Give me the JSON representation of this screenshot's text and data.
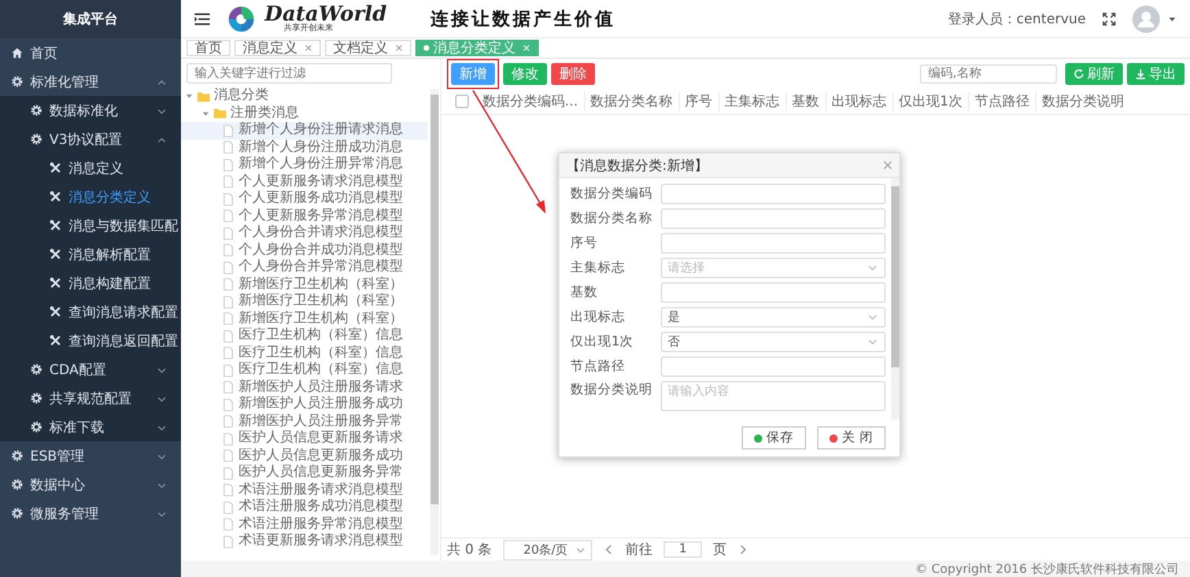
{
  "sidebar": {
    "title": "集成平台",
    "items": [
      {
        "label": "首页",
        "kind": "link"
      },
      {
        "label": "标准化管理",
        "kind": "group",
        "expanded": true,
        "children": [
          {
            "label": "数据标准化",
            "kind": "group",
            "expanded": false
          },
          {
            "label": "V3协议配置",
            "kind": "group",
            "expanded": true,
            "children": [
              {
                "label": "消息定义",
                "kind": "page",
                "selected": false
              },
              {
                "label": "消息分类定义",
                "kind": "page",
                "selected": true
              },
              {
                "label": "消息与数据集匹配",
                "kind": "page",
                "selected": false
              },
              {
                "label": "消息解析配置",
                "kind": "page",
                "selected": false
              },
              {
                "label": "消息构建配置",
                "kind": "page",
                "selected": false
              },
              {
                "label": "查询消息请求配置",
                "kind": "page",
                "selected": false
              },
              {
                "label": "查询消息返回配置",
                "kind": "page",
                "selected": false
              }
            ]
          },
          {
            "label": "CDA配置",
            "kind": "group",
            "expanded": false
          },
          {
            "label": "共享规范配置",
            "kind": "group",
            "expanded": false
          },
          {
            "label": "标准下载",
            "kind": "group",
            "expanded": false
          }
        ]
      },
      {
        "label": "ESB管理",
        "kind": "group",
        "expanded": false
      },
      {
        "label": "数据中心",
        "kind": "group",
        "expanded": false
      },
      {
        "label": "微服务管理",
        "kind": "group",
        "expanded": false
      }
    ]
  },
  "header": {
    "logo": {
      "name": "DataWorld",
      "tagline": "共享开创未来"
    },
    "slogan": "连接让数据产生价值",
    "user": "登录人员：centervue"
  },
  "tabs": [
    {
      "label": "首页",
      "closable": false,
      "selected": false
    },
    {
      "label": "消息定义",
      "closable": true,
      "selected": false
    },
    {
      "label": "文档定义",
      "closable": true,
      "selected": false
    },
    {
      "label": "消息分类定义",
      "closable": true,
      "selected": true
    }
  ],
  "tree": {
    "filter_placeholder": "输入关键字进行过滤",
    "nodes": [
      {
        "label": "消息分类",
        "kind": "folder",
        "expanded": true,
        "children": [
          {
            "label": "注册类消息",
            "kind": "folder",
            "expanded": true,
            "children": [
              {
                "label": "新增个人身份注册请求消息",
                "kind": "file",
                "selected": true
              },
              {
                "label": "新增个人身份注册成功消息",
                "kind": "file",
                "selected": false
              },
              {
                "label": "新增个人身份注册异常消息",
                "kind": "file",
                "selected": false
              },
              {
                "label": "个人更新服务请求消息模型",
                "kind": "file",
                "selected": false
              },
              {
                "label": "个人更新服务成功消息模型",
                "kind": "file",
                "selected": false
              },
              {
                "label": "个人更新服务异常消息模型",
                "kind": "file",
                "selected": false
              },
              {
                "label": "个人身份合并请求消息模型",
                "kind": "file",
                "selected": false
              },
              {
                "label": "个人身份合并成功消息模型",
                "kind": "file",
                "selected": false
              },
              {
                "label": "个人身份合并异常消息模型",
                "kind": "file",
                "selected": false
              },
              {
                "label": "新增医疗卫生机构（科室）",
                "kind": "file",
                "selected": false
              },
              {
                "label": "新增医疗卫生机构（科室）",
                "kind": "file",
                "selected": false
              },
              {
                "label": "新增医疗卫生机构（科室）",
                "kind": "file",
                "selected": false
              },
              {
                "label": "医疗卫生机构（科室）信息",
                "kind": "file",
                "selected": false
              },
              {
                "label": "医疗卫生机构（科室）信息",
                "kind": "file",
                "selected": false
              },
              {
                "label": "医疗卫生机构（科室）信息",
                "kind": "file",
                "selected": false
              },
              {
                "label": "新增医护人员注册服务请求",
                "kind": "file",
                "selected": false
              },
              {
                "label": "新增医护人员注册服务成功",
                "kind": "file",
                "selected": false
              },
              {
                "label": "新增医护人员注册服务异常",
                "kind": "file",
                "selected": false
              },
              {
                "label": "医护人员信息更新服务请求",
                "kind": "file",
                "selected": false
              },
              {
                "label": "医护人员信息更新服务成功",
                "kind": "file",
                "selected": false
              },
              {
                "label": "医护人员信息更新服务异常",
                "kind": "file",
                "selected": false
              },
              {
                "label": "术语注册服务请求消息模型",
                "kind": "file",
                "selected": false
              },
              {
                "label": "术语注册服务成功消息模型",
                "kind": "file",
                "selected": false
              },
              {
                "label": "术语注册服务异常消息模型",
                "kind": "file",
                "selected": false
              },
              {
                "label": "术语更新服务请求消息模型",
                "kind": "file",
                "selected": false
              }
            ]
          }
        ]
      }
    ]
  },
  "toolbar": {
    "buttons": [
      {
        "label": "新增",
        "kind": "add",
        "highlighted": true
      },
      {
        "label": "修改",
        "kind": "edit",
        "highlighted": false
      },
      {
        "label": "删除",
        "kind": "delete",
        "highlighted": false
      }
    ],
    "search_placeholder": "编码,名称",
    "actions": [
      {
        "label": "刷新",
        "kind": "refresh"
      },
      {
        "label": "导出",
        "kind": "export"
      }
    ]
  },
  "table": {
    "select_all": false,
    "columns": [
      "数据分类编码...",
      "数据分类名称",
      "序号",
      "主集标志",
      "基数",
      "出现标志",
      "仅出现1次",
      "节点路径",
      "数据分类说明"
    ]
  },
  "pagination": {
    "total": "共 0 条",
    "page_size": "20条/页",
    "goto": "前往",
    "page": "1",
    "page_unit": "页"
  },
  "annotation": {
    "arrow": true
  },
  "dialog": {
    "title": "【消息数据分类:新增】",
    "fields": [
      {
        "label": "数据分类编码",
        "kind": "text"
      },
      {
        "label": "数据分类名称",
        "kind": "text"
      },
      {
        "label": "序号",
        "kind": "text"
      },
      {
        "label": "主集标志",
        "kind": "select",
        "placeholder": "请选择"
      },
      {
        "label": "基数",
        "kind": "text"
      },
      {
        "label": "出现标志",
        "kind": "select",
        "value": "是"
      },
      {
        "label": "仅出现1次",
        "kind": "select",
        "value": "否"
      },
      {
        "label": "节点路径",
        "kind": "text"
      },
      {
        "label": "数据分类说明",
        "kind": "textarea",
        "placeholder": "请输入内容"
      }
    ],
    "buttons": [
      {
        "label": "保存",
        "kind": "save"
      },
      {
        "label": "关 闭",
        "kind": "close"
      }
    ]
  },
  "footer": "© Copyright 2016 长沙康氏软件科技有限公司"
}
